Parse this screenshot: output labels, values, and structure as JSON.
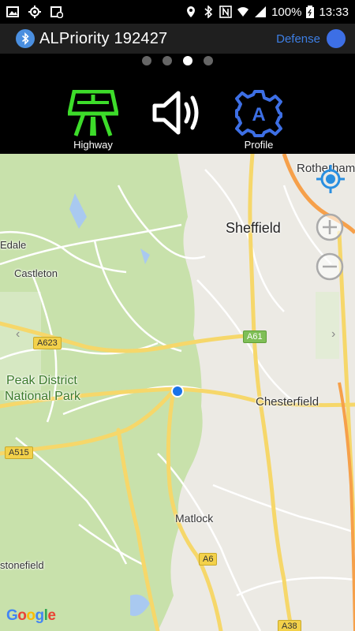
{
  "status_bar": {
    "battery": "100%",
    "time": "13:33",
    "left_icons": [
      "image-icon",
      "crosshair-icon",
      "calendar-icon"
    ],
    "right_icons": [
      "location-icon",
      "bluetooth-icon",
      "nfc-icon",
      "wifi-icon",
      "signal-icon",
      "battery-icon"
    ]
  },
  "app_bar": {
    "title": "ALPriority 192427",
    "mode_label": "Defense",
    "accent": "#3d7fe5"
  },
  "pager": {
    "pages": 4,
    "active_index": 2
  },
  "actions": [
    {
      "label": "Highway",
      "icon": "highway-icon",
      "color": "#3ddc2a"
    },
    {
      "label": "",
      "icon": "speaker-icon",
      "color": "#ffffff"
    },
    {
      "label": "Profile",
      "icon": "profile-gear-icon",
      "color": "#3d6fe5",
      "glyph": "A"
    }
  ],
  "map": {
    "places": {
      "rotherham": "Rotherham",
      "sheffield": "Sheffield",
      "edale": "Edale",
      "castleton": "Castleton",
      "peak_district": "Peak District",
      "national_park": "National Park",
      "chesterfield": "Chesterfield",
      "matlock": "Matlock",
      "stonefield": "stonefield"
    },
    "roads": {
      "a61": "A61",
      "a623": "A623",
      "a515": "A515",
      "a6": "A6",
      "a38": "A38"
    },
    "attribution": "Google",
    "controls": [
      "my-location-button",
      "zoom-in-button",
      "zoom-out-button"
    ]
  }
}
